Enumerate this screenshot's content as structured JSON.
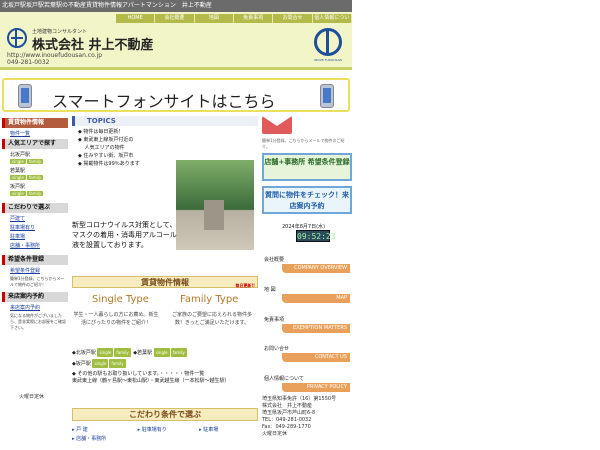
{
  "topbar": {
    "text": "北坂戸駅坂戸駅若葉駅の不動産賃貸物件情報アパートマンション　井上不動産"
  },
  "nav": {
    "items": [
      "HOME",
      "会社概要",
      "地図",
      "免責事項",
      "お問合せ",
      "個人情報について"
    ]
  },
  "company": {
    "sub": "土地建物コンサルタント",
    "name": "株式会社 井上不動産",
    "url": "http://www.inouefudousan.co.jp",
    "tel": "049-281-0032",
    "logo_caption": "INOUE FUDOUSAN"
  },
  "smart": {
    "text": "スマートフォンサイトはこちら"
  },
  "sidebar": {
    "property_h": "賃貸物件情報",
    "property_link": "物件一覧",
    "popular_h": "人気エリアで探す",
    "areas": [
      "北坂戸駅",
      "若葉駅",
      "坂戸駅"
    ],
    "tag_single": "single",
    "tag_family": "family",
    "kodawari_h": "こだわりで選ぶ",
    "kodawari": [
      "戸建て",
      "駐車場有り",
      "駐車場",
      "店舗・事務所"
    ],
    "kibou_h": "希望条件登録",
    "kibou_link": "希望条件登録",
    "kibou_note": "簡単1分登録。こちらからメールで物件のご紹介！",
    "store_h": "来店案内予約",
    "store_link": "来店案内予約",
    "store_note": "気になる物件がございましたら、是非実際にお部屋をご確認下さい。",
    "holiday": "火曜日定休"
  },
  "topics": {
    "heading": "TOPICS",
    "items": [
      "◆ 物件は毎日更新！",
      "◆ 東武東上線坂戸付近の",
      "　 人気エリアの物件",
      "◆ 住みやすい街、坂戸市",
      "◆ 掲載物件は99％あります"
    ]
  },
  "corona": {
    "text": "新型コロナウイルス対策として、マスクの着用・消毒用アルコール液を設置しております。"
  },
  "chintai": {
    "heading": "賃貸物件情報",
    "new": "毎日更新!!"
  },
  "types": {
    "single_t": "Single Type",
    "single_d": "学生・一人暮らしの方にお薦め。新生活にぴったりの物件をご紹介！",
    "family_t": "Family Type",
    "family_d": "ご家族のご要望に応えられる物件多数！きっとご満足いただけます。"
  },
  "stations": {
    "kita": "北坂戸駅",
    "wakaba": "若葉駅",
    "sakado": "坂戸駅"
  },
  "other": {
    "text": "◆ その他の駅もお取り扱いしています。・・・・・物件一覧",
    "lines": "東武東上線（鶴ヶ島駅～東松山駅）・東武越生線（一本松駅～越生駅）"
  },
  "kodawari": {
    "heading": "こだわり条件で選ぶ",
    "items": [
      "戸 建",
      "駐車場有り",
      "駐車場",
      "店舗・事務所"
    ]
  },
  "right": {
    "mail_note": "簡単1分登録。こちらからメールで物件のご紹介。",
    "btn1": "店舗+事務所 希望条件登録",
    "btn2": "質問に物件をチェック！来店案内予約",
    "date": "2024年8月7日(水)",
    "clock": "09:52:23",
    "sections": [
      {
        "jp": "会社概要",
        "en": "COMPANY OVERVIEW"
      },
      {
        "jp": "地 図",
        "en": "MAP"
      },
      {
        "jp": "免責事項",
        "en": "EXEMPTION MATTERS"
      },
      {
        "jp": "お問い合せ",
        "en": "CONTACT US"
      },
      {
        "jp": "個人情報について",
        "en": "PRIVACY POLICY"
      }
    ],
    "address": [
      "埼玉県知事免許（16）第1550号",
      "株式会社　井上不動産",
      "埼玉県坂戸市芦山町6-8",
      "TEL：049-281-0032",
      "Fax：049-289-1770",
      "火曜日定休"
    ]
  }
}
